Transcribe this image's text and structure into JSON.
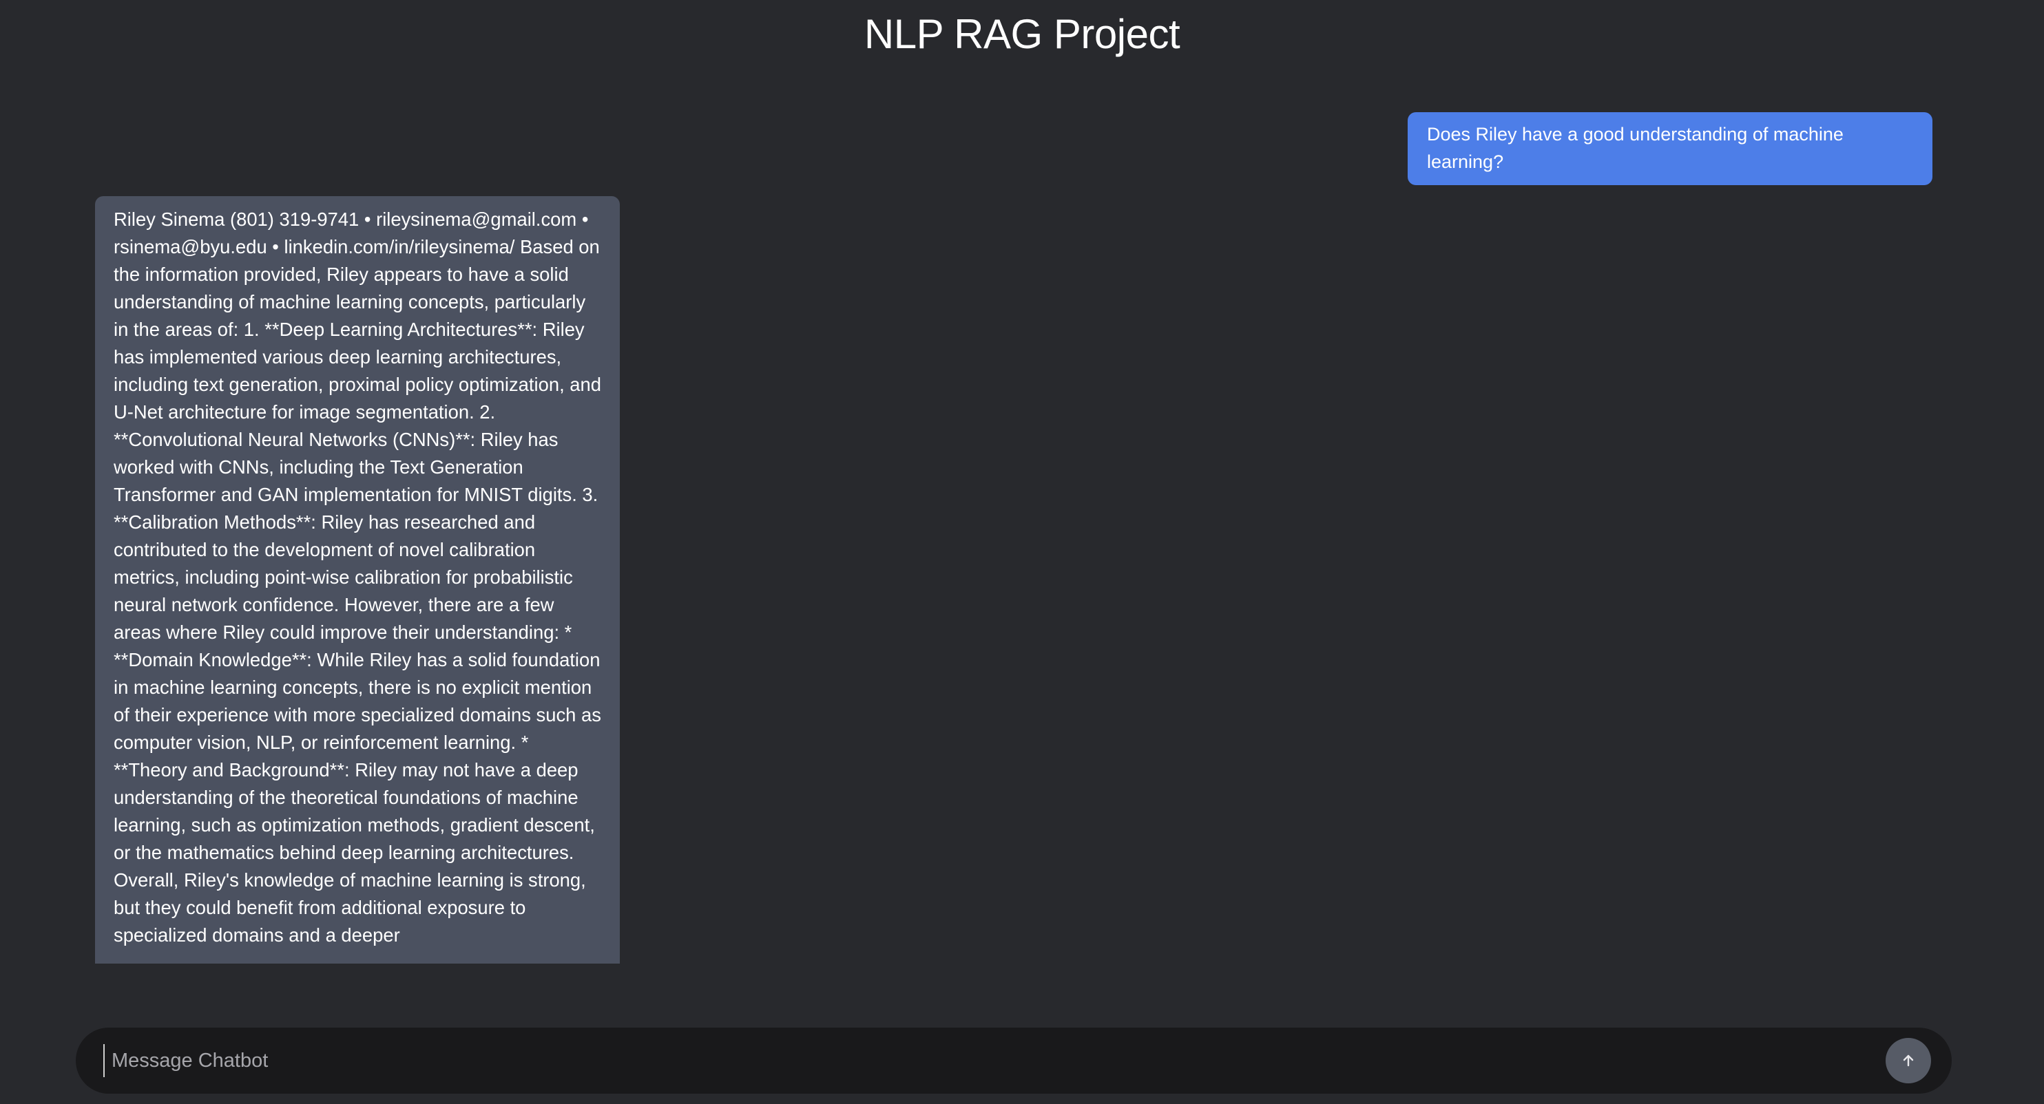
{
  "header": {
    "title": "NLP RAG Project"
  },
  "chat": {
    "messages": [
      {
        "role": "user",
        "text": "Does Riley have a good understanding of machine learning?"
      },
      {
        "role": "bot",
        "text": "Riley Sinema (801) 319-9741 • rileysinema@gmail.com • rsinema@byu.edu • linkedin.com/in/rileysinema/ Based on the information provided, Riley appears to have a solid understanding of machine learning concepts, particularly in the areas of: 1. **Deep Learning Architectures**: Riley has implemented various deep learning architectures, including text generation, proximal policy optimization, and U-Net architecture for image segmentation. 2. **Convolutional Neural Networks (CNNs)**: Riley has worked with CNNs, including the Text Generation Transformer and GAN implementation for MNIST digits. 3. **Calibration Methods**: Riley has researched and contributed to the development of novel calibration metrics, including point-wise calibration for probabilistic neural network confidence. However, there are a few areas where Riley could improve their understanding: * **Domain Knowledge**: While Riley has a solid foundation in machine learning concepts, there is no explicit mention of their experience with more specialized domains such as computer vision, NLP, or reinforcement learning. * **Theory and Background**: Riley may not have a deep understanding of the theoretical foundations of machine learning, such as optimization methods, gradient descent, or the mathematics behind deep learning architectures. Overall, Riley's knowledge of machine learning is strong, but they could benefit from additional exposure to specialized domains and a deeper"
      }
    ]
  },
  "composer": {
    "placeholder": "Message Chatbot",
    "value": "",
    "send_icon": "arrow-up-icon"
  },
  "colors": {
    "background": "#28292d",
    "user_bubble": "#4d7ee8",
    "bot_bubble": "#4b5160",
    "composer": "#19191b",
    "send_button": "#565b66"
  }
}
